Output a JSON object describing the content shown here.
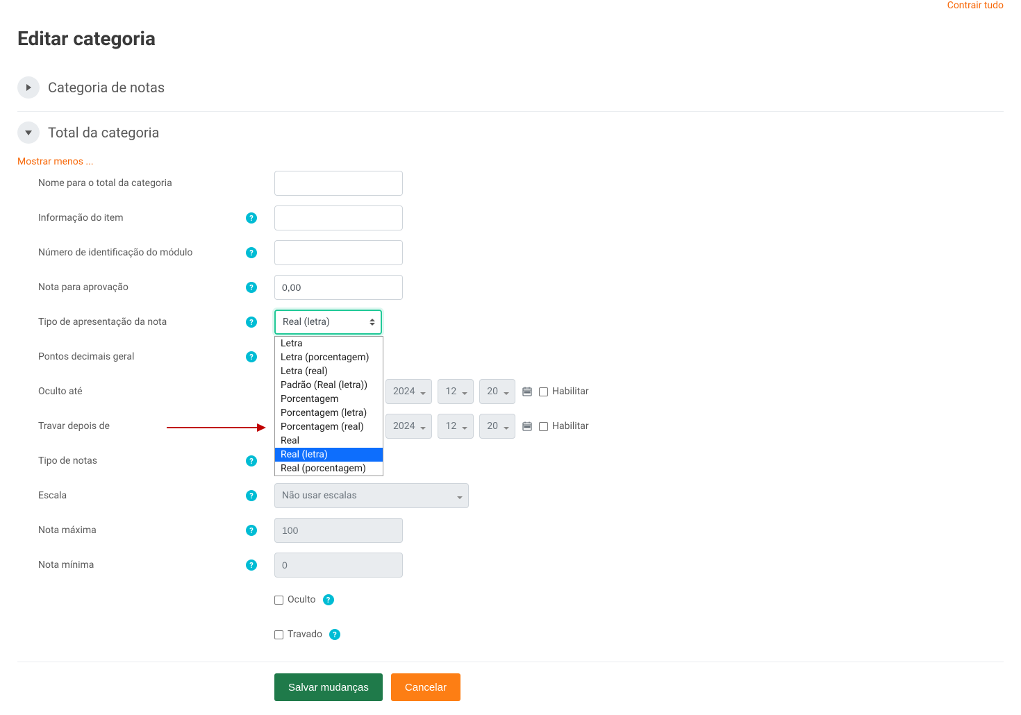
{
  "page": {
    "title": "Editar categoria",
    "collapse_all_link": "Contrair tudo"
  },
  "sections": {
    "categoria_notas": "Categoria de notas",
    "total_categoria": "Total da categoria"
  },
  "show_less_link": "Mostrar menos ...",
  "fields": {
    "nome_total": {
      "label": "Nome para o total da categoria",
      "value": ""
    },
    "info_item": {
      "label": "Informação do item",
      "value": ""
    },
    "numero_id": {
      "label": "Número de identificação do módulo",
      "value": ""
    },
    "nota_aprovacao": {
      "label": "Nota para aprovação",
      "value": "0,00"
    },
    "tipo_apresentacao": {
      "label": "Tipo de apresentação da nota",
      "value": "Real (letra)"
    },
    "pontos_decimais": {
      "label": "Pontos decimais geral"
    },
    "oculto_ate": {
      "label": "Oculto até",
      "year": "2024",
      "hour": "12",
      "minute": "20",
      "enable_label": "Habilitar"
    },
    "travar_depois": {
      "label": "Travar depois de",
      "year": "2024",
      "hour": "12",
      "minute": "20",
      "enable_label": "Habilitar"
    },
    "tipo_notas": {
      "label": "Tipo de notas"
    },
    "escala": {
      "label": "Escala",
      "value": "Não usar escalas"
    },
    "nota_maxima": {
      "label": "Nota máxima",
      "value": "100"
    },
    "nota_minima": {
      "label": "Nota mínima",
      "value": "0"
    },
    "oculto_checkbox": "Oculto",
    "travado_checkbox": "Travado"
  },
  "dropdown_options": [
    "Letra",
    "Letra (porcentagem)",
    "Letra (real)",
    "Padrão (Real (letra))",
    "Porcentagem",
    "Porcentagem (letra)",
    "Porcentagem (real)",
    "Real",
    "Real (letra)",
    "Real (porcentagem)"
  ],
  "dropdown_selected_index": 8,
  "buttons": {
    "save": "Salvar mudanças",
    "cancel": "Cancelar"
  },
  "icons": {
    "help_glyph": "?"
  }
}
